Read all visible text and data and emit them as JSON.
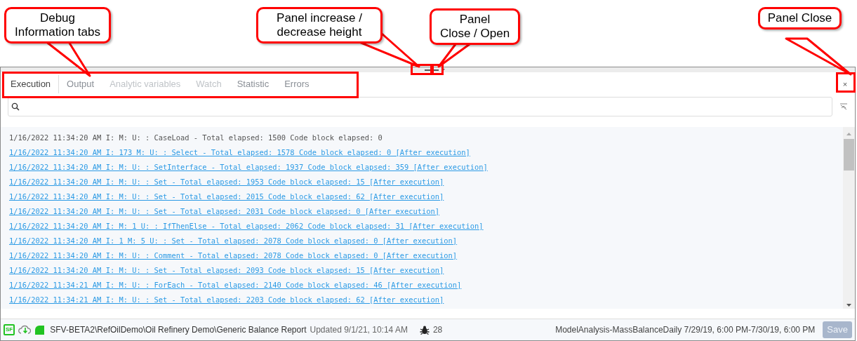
{
  "callouts": [
    {
      "lines": [
        "Debug",
        "Information tabs"
      ]
    },
    {
      "lines": [
        "Panel increase /",
        "decrease height"
      ]
    },
    {
      "lines": [
        "Panel",
        "Close / Open"
      ]
    },
    {
      "lines": [
        "Panel Close"
      ]
    }
  ],
  "panel": {
    "close": "×"
  },
  "tabs": [
    {
      "label": "Execution",
      "selected": true,
      "disabled": false
    },
    {
      "label": "Output",
      "selected": false,
      "disabled": false
    },
    {
      "label": "Analytic variables",
      "selected": false,
      "disabled": true
    },
    {
      "label": "Watch",
      "selected": false,
      "disabled": true
    },
    {
      "label": "Statistic",
      "selected": false,
      "disabled": false
    },
    {
      "label": "Errors",
      "selected": false,
      "disabled": false
    }
  ],
  "log": [
    {
      "kind": "plain",
      "text": "1/16/2022 11:34:20 AM I: M: U: : CaseLoad - Total elapsed: 1500 Code block elapsed: 0"
    },
    {
      "kind": "link",
      "text": "1/16/2022 11:34:20 AM I: 173 M: U: : Select - Total elapsed: 1578 Code block elapsed: 0 [After execution]"
    },
    {
      "kind": "link",
      "text": "1/16/2022 11:34:20 AM I: M: U: : SetInterface - Total elapsed: 1937 Code block elapsed: 359 [After execution]"
    },
    {
      "kind": "link",
      "text": "1/16/2022 11:34:20 AM I: M: U: : Set - Total elapsed: 1953 Code block elapsed: 15 [After execution]"
    },
    {
      "kind": "link",
      "text": "1/16/2022 11:34:20 AM I: M: U: : Set - Total elapsed: 2015 Code block elapsed: 62 [After execution]"
    },
    {
      "kind": "link",
      "text": "1/16/2022 11:34:20 AM I: M: U: : Set - Total elapsed: 2031 Code block elapsed: 0 [After execution]"
    },
    {
      "kind": "link",
      "text": "1/16/2022 11:34:20 AM I: M: 1 U: : IfThenElse - Total elapsed: 2062 Code block elapsed: 31 [After execution]"
    },
    {
      "kind": "link",
      "text": "1/16/2022 11:34:20 AM I: 1 M: 5 U: : Set - Total elapsed: 2078 Code block elapsed: 0 [After execution]"
    },
    {
      "kind": "link",
      "text": "1/16/2022 11:34:20 AM I: M: U: : Comment - Total elapsed: 2078 Code block elapsed: 0 [After execution]"
    },
    {
      "kind": "link",
      "text": "1/16/2022 11:34:20 AM I: M: U: : Set - Total elapsed: 2093 Code block elapsed: 15 [After execution]"
    },
    {
      "kind": "link",
      "text": "1/16/2022 11:34:21 AM I: M: U: : ForEach - Total elapsed: 2140 Code block elapsed: 46 [After execution]"
    },
    {
      "kind": "link",
      "text": "1/16/2022 11:34:21 AM I: M: U: : Set - Total elapsed: 2203 Code block elapsed: 62 [After execution]"
    }
  ],
  "status_bar": {
    "badge": "SF",
    "path": "SFV-BETA2\\RefOilDemo\\Oil Refinery Demo\\Generic Balance Report",
    "updated": "Updated 9/1/21, 10:14 AM",
    "bug_count": "28",
    "model": "ModelAnalysis-MassBalanceDaily 7/29/19, 6:00 PM-7/30/19, 6:00 PM",
    "save": {
      "label": "Save",
      "disabled": true
    }
  }
}
